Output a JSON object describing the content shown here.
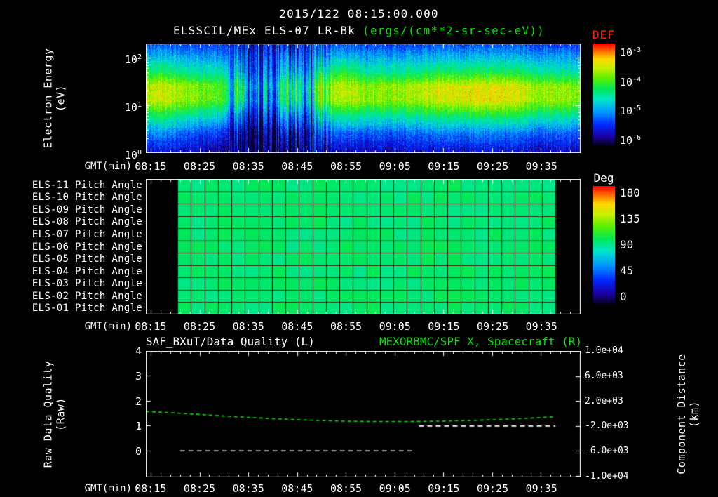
{
  "colors": {
    "background": "#000000",
    "text": "#ffffff",
    "accent_green": "#00e400",
    "accent_red": "#ff2a00",
    "line_green": "#00dd00",
    "line_white": "#ffffff",
    "colormap_stops": [
      [
        0.0,
        "#06001e"
      ],
      [
        0.08,
        "#1c00a0"
      ],
      [
        0.2,
        "#0028ff"
      ],
      [
        0.33,
        "#009cff"
      ],
      [
        0.45,
        "#00e6c8"
      ],
      [
        0.55,
        "#00e85c"
      ],
      [
        0.66,
        "#5af000"
      ],
      [
        0.76,
        "#c8f000"
      ],
      [
        0.85,
        "#ffd800"
      ],
      [
        0.92,
        "#ff7800"
      ],
      [
        1.0,
        "#ff0000"
      ]
    ]
  },
  "header": {
    "datetime": "2015/122 08:15:00.000",
    "title": "ELSSCIL/MEx ELS-07 LR-Bk",
    "units": "(ergs/(cm**2-sr-sec-eV))"
  },
  "time_axis": {
    "label": "GMT(min)",
    "ticks": [
      "08:15",
      "08:25",
      "08:35",
      "08:45",
      "08:55",
      "09:05",
      "09:15",
      "09:25",
      "09:35"
    ],
    "tick_minutes": [
      495,
      505,
      515,
      525,
      535,
      545,
      555,
      565,
      575
    ],
    "range_minutes": [
      494,
      583
    ]
  },
  "chart_data": [
    {
      "type": "heatmap",
      "name": "electron-energy-spectrogram",
      "ylabel_line1": "Electron Energy",
      "ylabel_line2": "(eV)",
      "y_scale": "log10",
      "y_range_ev": [
        1,
        200
      ],
      "yticks": [
        {
          "b": "10",
          "e": "2"
        },
        {
          "b": "10",
          "e": "1"
        },
        {
          "b": "10",
          "e": "0"
        }
      ],
      "colorbar": {
        "label": "DEF",
        "ticks": [
          {
            "b": "10",
            "e": "-3"
          },
          {
            "b": "10",
            "e": "-4"
          },
          {
            "b": "10",
            "e": "-5"
          },
          {
            "b": "10",
            "e": "-6"
          }
        ],
        "range_log10": [
          -6,
          -3
        ]
      },
      "time_min": [
        494,
        499,
        504,
        509,
        514,
        519,
        524,
        529,
        534,
        539,
        544,
        549,
        554,
        559,
        564,
        569,
        574,
        579,
        584
      ],
      "log10_energy": [
        0,
        0.4,
        0.8,
        1.1,
        1.4,
        1.7,
        2.0,
        2.3
      ],
      "values_log10": [
        [
          -5.6,
          -5.1,
          -4.3,
          -3.7,
          -3.7,
          -4.3,
          -4.8,
          -5.3
        ],
        [
          -5.6,
          -5.1,
          -4.35,
          -3.75,
          -3.75,
          -4.35,
          -4.85,
          -5.3
        ],
        [
          -5.7,
          -5.3,
          -4.55,
          -3.95,
          -3.95,
          -4.55,
          -4.95,
          -5.4
        ],
        [
          -5.8,
          -5.4,
          -4.7,
          -4.1,
          -4.1,
          -4.6,
          -5.0,
          -5.4
        ],
        [
          -5.9,
          -5.6,
          -5.0,
          -4.4,
          -4.35,
          -4.8,
          -5.1,
          -5.5
        ],
        [
          -5.9,
          -5.5,
          -4.9,
          -4.3,
          -4.3,
          -4.75,
          -5.1,
          -5.5
        ],
        [
          -5.9,
          -5.6,
          -5.0,
          -4.45,
          -4.4,
          -4.8,
          -5.15,
          -5.5
        ],
        [
          -5.8,
          -5.4,
          -4.75,
          -4.15,
          -4.1,
          -4.65,
          -5.05,
          -5.45
        ],
        [
          -5.7,
          -5.2,
          -4.4,
          -3.75,
          -3.7,
          -4.2,
          -4.8,
          -5.3
        ],
        [
          -5.7,
          -5.25,
          -4.5,
          -3.9,
          -3.9,
          -4.5,
          -4.9,
          -5.35
        ],
        [
          -5.7,
          -5.25,
          -4.5,
          -3.9,
          -3.85,
          -4.5,
          -4.9,
          -5.35
        ],
        [
          -5.65,
          -5.2,
          -4.45,
          -3.85,
          -3.8,
          -4.45,
          -4.9,
          -5.35
        ],
        [
          -5.65,
          -5.15,
          -4.35,
          -3.7,
          -3.65,
          -4.35,
          -4.85,
          -5.3
        ],
        [
          -5.6,
          -5.1,
          -4.3,
          -3.6,
          -3.6,
          -4.3,
          -4.8,
          -5.3
        ],
        [
          -5.6,
          -5.1,
          -4.25,
          -3.55,
          -3.6,
          -4.3,
          -4.8,
          -5.3
        ],
        [
          -5.6,
          -5.15,
          -4.3,
          -3.65,
          -3.65,
          -4.35,
          -4.85,
          -5.3
        ],
        [
          -5.65,
          -5.2,
          -4.4,
          -3.8,
          -3.8,
          -4.45,
          -4.9,
          -5.35
        ],
        [
          -5.65,
          -5.2,
          -4.45,
          -3.85,
          -3.85,
          -4.5,
          -4.9,
          -5.35
        ],
        [
          -5.7,
          -5.25,
          -4.5,
          -3.9,
          -3.9,
          -4.5,
          -4.95,
          -5.4
        ]
      ],
      "dropouts_min": [
        511.5,
        514.8,
        516.3,
        517.6,
        519.2,
        520.5,
        526.5,
        528.0
      ],
      "dropout_depth_log10": 1.1
    },
    {
      "type": "heatmap",
      "name": "pitch-angle-grid",
      "row_labels": [
        "ELS-11 Pitch Angle",
        "ELS-10 Pitch Angle",
        "ELS-09 Pitch Angle",
        "ELS-08 Pitch Angle",
        "ELS-07 Pitch Angle",
        "ELS-06 Pitch Angle",
        "ELS-05 Pitch Angle",
        "ELS-04 Pitch Angle",
        "ELS-03 Pitch Angle",
        "ELS-02 Pitch Angle",
        "ELS-01 Pitch Angle"
      ],
      "colorbar": {
        "label": "Deg",
        "ticks": [
          "180",
          "135",
          "90",
          "45",
          "0"
        ],
        "range_deg": [
          0,
          180
        ]
      },
      "data_start_min": 500.5,
      "data_end_min": 578,
      "columns": 28,
      "mean_value_deg": 96
    },
    {
      "type": "line",
      "name": "quality-and-spacecraft-distance",
      "title_left": "SAF_BXuT/Data Quality (L)",
      "title_right": "MEXORBMC/SPF X, Spacecraft (R)",
      "left_axis": {
        "label_line1": "Raw Data Quality",
        "label_line2": "(Raw)",
        "ticks": [
          "4",
          "3",
          "2",
          "1",
          "0"
        ],
        "range": [
          -1.05,
          4
        ]
      },
      "right_axis": {
        "label_line1": "Component Distance",
        "label_line2": "(km)",
        "ticks": [
          "1.0e+04",
          "6.0e+03",
          "2.0e+03",
          "-2.0e+03",
          "-6.0e+03",
          "-1.0e+04"
        ],
        "tick_km": [
          10000,
          6000,
          2000,
          -2000,
          -6000,
          -10000
        ],
        "range_km": [
          -10100,
          10000
        ]
      },
      "series": [
        {
          "name": "SAF_BXuT/Data Quality (L)",
          "axis": "left",
          "color": "#ffffff",
          "dash": [
            7,
            5
          ],
          "segments": [
            {
              "t_min": [
                501,
                549
              ],
              "value": [
                0,
                0
              ]
            },
            {
              "t_min": [
                550,
                578
              ],
              "value": [
                1,
                1
              ]
            }
          ]
        },
        {
          "name": "MEXORBMC/SPF X, Spacecraft (R)",
          "axis": "right",
          "color": "#00dd00",
          "dash": [
            5,
            4
          ],
          "t_min": [
            494,
            500,
            505,
            510,
            515,
            520,
            525,
            530,
            535,
            540,
            545,
            550,
            555,
            560,
            565,
            570,
            575,
            578
          ],
          "km": [
            330,
            80,
            -150,
            -400,
            -620,
            -820,
            -990,
            -1130,
            -1230,
            -1280,
            -1290,
            -1270,
            -1220,
            -1130,
            -1010,
            -850,
            -650,
            -520
          ]
        }
      ]
    }
  ]
}
